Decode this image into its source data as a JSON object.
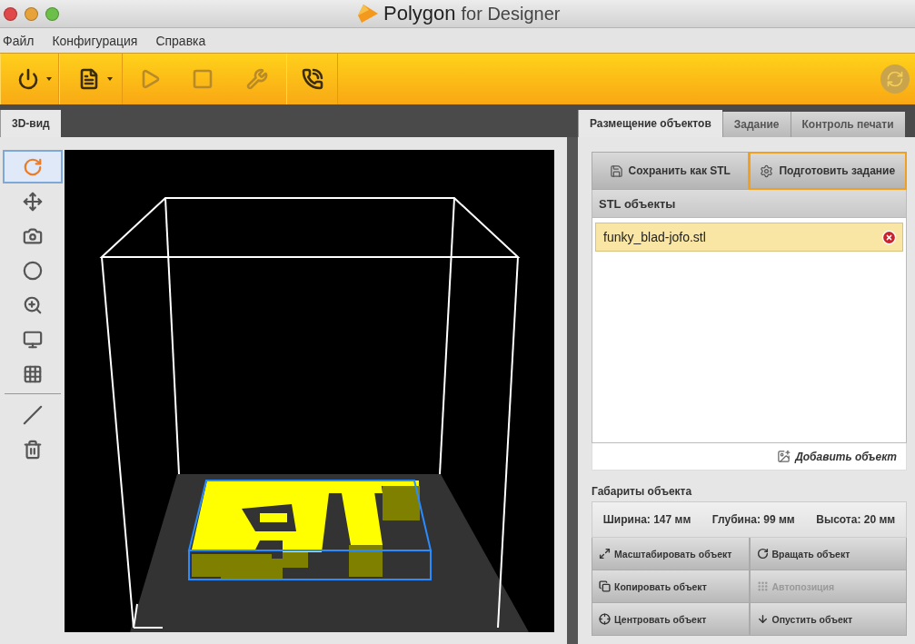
{
  "window": {
    "brand": "Polygon",
    "brand_suffix": "for Designer"
  },
  "menu": [
    "Файл",
    "Конфигурация",
    "Справка"
  ],
  "toolbar": [
    {
      "kind": "power",
      "dropdown": true,
      "disabled": false
    },
    {
      "kind": "document",
      "dropdown": true,
      "disabled": false
    },
    {
      "kind": "play",
      "dropdown": false,
      "disabled": true
    },
    {
      "kind": "stop",
      "dropdown": false,
      "disabled": true
    },
    {
      "kind": "wrench",
      "dropdown": false,
      "disabled": true
    },
    {
      "kind": "support",
      "dropdown": false,
      "disabled": false
    }
  ],
  "view_tabs": [
    {
      "label": "3D-вид",
      "selected": true
    }
  ],
  "tool_groups": [
    {
      "tools": [
        {
          "kind": "rotate",
          "selected": true
        },
        {
          "kind": "move",
          "selected": false
        },
        {
          "kind": "move-camera",
          "selected": false
        },
        {
          "kind": "move-light",
          "selected": false
        },
        {
          "kind": "zoom",
          "selected": false
        },
        {
          "kind": "front-view",
          "selected": false
        },
        {
          "kind": "grid",
          "selected": false
        }
      ]
    },
    {
      "tools": [
        {
          "kind": "slice",
          "selected": false
        },
        {
          "kind": "delete",
          "selected": false
        }
      ]
    }
  ],
  "panel_tabs": [
    {
      "label": "Размещение объектов",
      "selected": true
    },
    {
      "label": "Задание",
      "selected": false
    },
    {
      "label": "Контроль печати",
      "selected": false
    }
  ],
  "panel_buttons": [
    {
      "kind": "save",
      "label": "Сохранить как STL",
      "highlighted": false
    },
    {
      "kind": "prepare",
      "label": "Подготовить задание",
      "highlighted": true
    }
  ],
  "stl_objects": {
    "title": "STL объекты",
    "items": [
      {
        "name": "funky_blad-jofo.stl",
        "selected": true
      }
    ],
    "add_label": "Добавить объект"
  },
  "dimensions": {
    "title": "Габариты объекта",
    "values": [
      "Ширина: 147 мм",
      "Глубина: 99 мм",
      "Высота: 20 мм"
    ]
  },
  "actions": [
    {
      "kind": "scale",
      "label": "Масштабировать объект",
      "disabled": false
    },
    {
      "kind": "rotate",
      "label": "Вращать объект",
      "disabled": false
    },
    {
      "kind": "copy",
      "label": "Копировать объект",
      "disabled": false
    },
    {
      "kind": "autoposition",
      "label": "Автопозиция",
      "disabled": true
    },
    {
      "kind": "center",
      "label": "Центровать объект",
      "disabled": false
    },
    {
      "kind": "drop",
      "label": "Опустить объект",
      "disabled": false
    }
  ]
}
